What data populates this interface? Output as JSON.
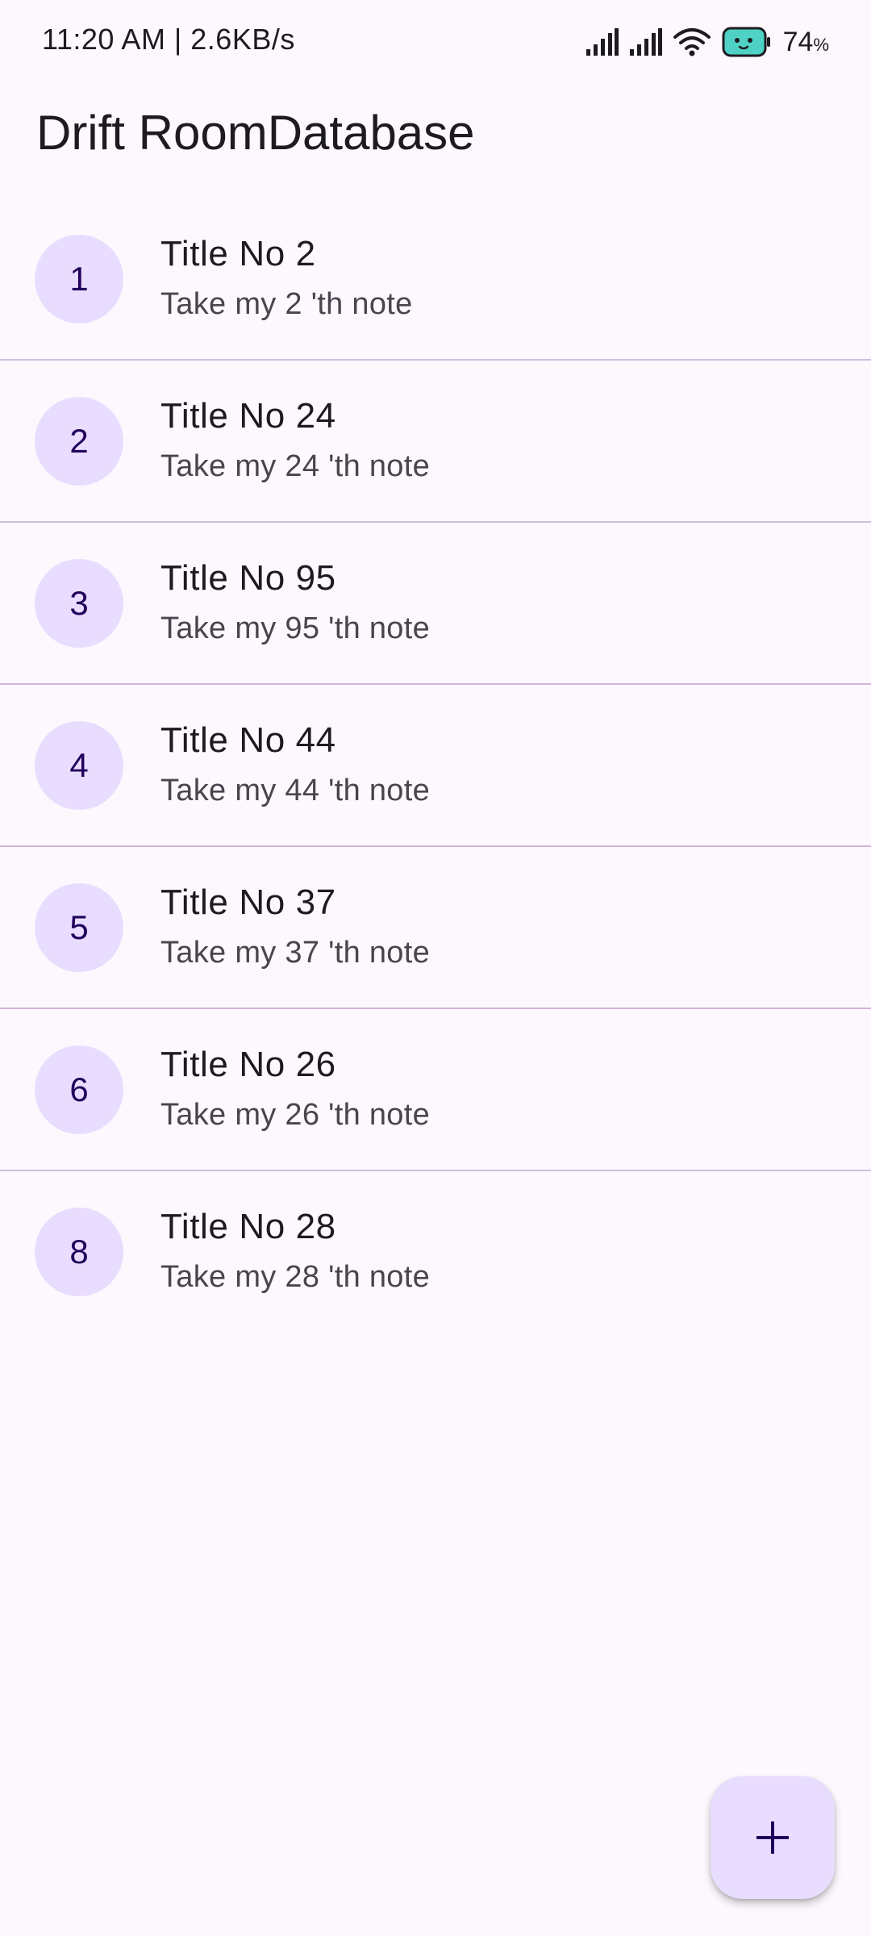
{
  "status_bar": {
    "time": "11:20 AM | 2.6KB/s",
    "battery_level": "74",
    "battery_unit": "%"
  },
  "app_bar": {
    "title": "Drift RoomDatabase"
  },
  "notes": [
    {
      "index": "1",
      "title": "Title No 2",
      "subtitle": "Take my 2 'th note"
    },
    {
      "index": "2",
      "title": "Title No 24",
      "subtitle": "Take my 24 'th note"
    },
    {
      "index": "3",
      "title": "Title No 95",
      "subtitle": "Take my 95 'th note"
    },
    {
      "index": "4",
      "title": "Title No 44",
      "subtitle": "Take my 44 'th note"
    },
    {
      "index": "5",
      "title": "Title No 37",
      "subtitle": "Take my 37 'th note"
    },
    {
      "index": "6",
      "title": "Title No 26",
      "subtitle": "Take my 26 'th note"
    },
    {
      "index": "8",
      "title": "Title No 28",
      "subtitle": "Take my 28 'th note"
    }
  ],
  "fab": {
    "icon": "plus-icon"
  },
  "colors": {
    "background": "#fdf8fd",
    "avatar_bg": "#e9ddff",
    "avatar_text": "#21005d",
    "divider": "#cdbfe0",
    "fab_bg": "#e9ddff"
  }
}
